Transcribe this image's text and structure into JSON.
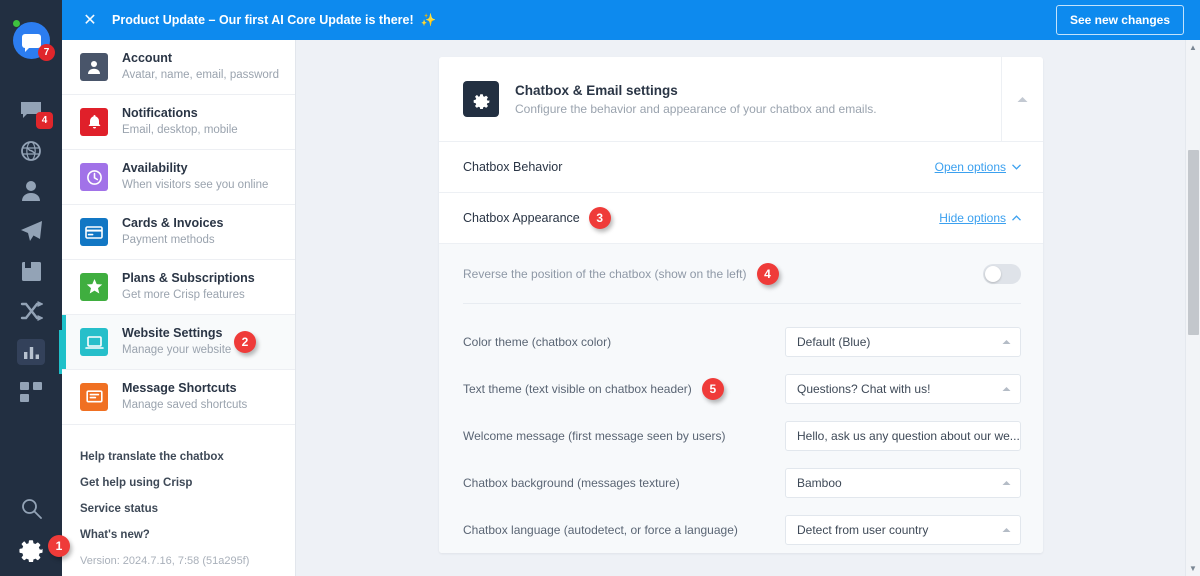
{
  "banner": {
    "close_icon": "close-icon",
    "text": "Product Update – Our first AI Core Update is there!",
    "emoji": "✨",
    "button_label": "See new changes",
    "bg_color": "#0d8aee"
  },
  "rail": {
    "logo_badge": "7",
    "chat_badge": "4",
    "icons": [
      {
        "name": "chat-logo-icon",
        "label": "Crisp logo"
      },
      {
        "name": "conversations-icon",
        "label": "Conversations"
      },
      {
        "name": "globe-icon",
        "label": "Visitors"
      },
      {
        "name": "contacts-icon",
        "label": "Contacts"
      },
      {
        "name": "campaigns-icon",
        "label": "Campaigns"
      },
      {
        "name": "helpdesk-icon",
        "label": "Helpdesk"
      },
      {
        "name": "plugins-icon",
        "label": "Plugins"
      },
      {
        "name": "analytics-icon",
        "label": "Analytics"
      },
      {
        "name": "apps-icon",
        "label": "Apps"
      },
      {
        "name": "search-icon",
        "label": "Search"
      },
      {
        "name": "settings-gear-icon",
        "label": "Settings"
      }
    ],
    "settings_marker": "1",
    "bg_color": "#222f41",
    "accent_color": "#1fc0c9"
  },
  "nav": {
    "items": [
      {
        "title": "Account",
        "subtitle": "Avatar, name, email, password",
        "icon": "person-icon",
        "color": "#49556a",
        "selected": false,
        "marker": ""
      },
      {
        "title": "Notifications",
        "subtitle": "Email, desktop, mobile",
        "icon": "bell-icon",
        "color": "#e0202a",
        "selected": false,
        "marker": ""
      },
      {
        "title": "Availability",
        "subtitle": "When visitors see you online",
        "icon": "clock-icon",
        "color": "#a172e8",
        "selected": false,
        "marker": ""
      },
      {
        "title": "Cards & Invoices",
        "subtitle": "Payment methods",
        "icon": "card-icon",
        "color": "#1277c4",
        "selected": false,
        "marker": ""
      },
      {
        "title": "Plans & Subscriptions",
        "subtitle": "Get more Crisp features",
        "icon": "star-icon",
        "color": "#3fae3f",
        "selected": false,
        "marker": ""
      },
      {
        "title": "Website Settings",
        "subtitle": "Manage your website",
        "icon": "laptop-icon",
        "color": "#26bfca",
        "selected": true,
        "marker": "2"
      },
      {
        "title": "Message Shortcuts",
        "subtitle": "Manage saved shortcuts",
        "icon": "shortcut-icon",
        "color": "#f07022",
        "selected": false,
        "marker": ""
      }
    ],
    "links": [
      {
        "label": "Help translate the chatbox",
        "marker": ""
      },
      {
        "label": "Get help using Crisp",
        "marker": ""
      },
      {
        "label": "Service status",
        "marker": ""
      },
      {
        "label": "What's new?",
        "marker": ""
      }
    ],
    "version": "Version: 2024.7.16, 7:58 (51a295f)"
  },
  "panel": {
    "icon": "gear-icon",
    "title": "Chatbox & Email settings",
    "subtitle": "Configure the behavior and appearance of your chatbox and emails.",
    "collapse_icon": "chevron-up-icon",
    "sections": [
      {
        "label": "Chatbox Behavior",
        "link": "Open options",
        "link_icon": "chevron-down-icon",
        "marker": ""
      },
      {
        "label": "Chatbox Appearance",
        "link": "Hide options",
        "link_icon": "chevron-up-icon",
        "marker": "3"
      }
    ],
    "toggle_option": {
      "label": "Reverse the position of the chatbox (show on the left)",
      "marker": "4",
      "state": "off"
    },
    "fields": [
      {
        "label": "Color theme (chatbox color)",
        "value": "Default (Blue)",
        "marker": ""
      },
      {
        "label": "Text theme (text visible on chatbox header)",
        "value": "Questions? Chat with us!",
        "marker": "5"
      },
      {
        "label": "Welcome message (first message seen by users)",
        "value": "Hello, ask us any question about our we...",
        "marker": ""
      },
      {
        "label": "Chatbox background (messages texture)",
        "value": "Bamboo",
        "marker": ""
      },
      {
        "label": "Chatbox language (autodetect, or force a language)",
        "value": "Detect from user country",
        "marker": ""
      }
    ]
  },
  "scrollbar": {
    "up_arrow": "triangle-up-icon",
    "down_arrow": "triangle-down-icon"
  },
  "colors": {
    "marker_red": "#ef3b39",
    "link_blue": "#3ba0ef",
    "teal": "#1fc0c9"
  }
}
